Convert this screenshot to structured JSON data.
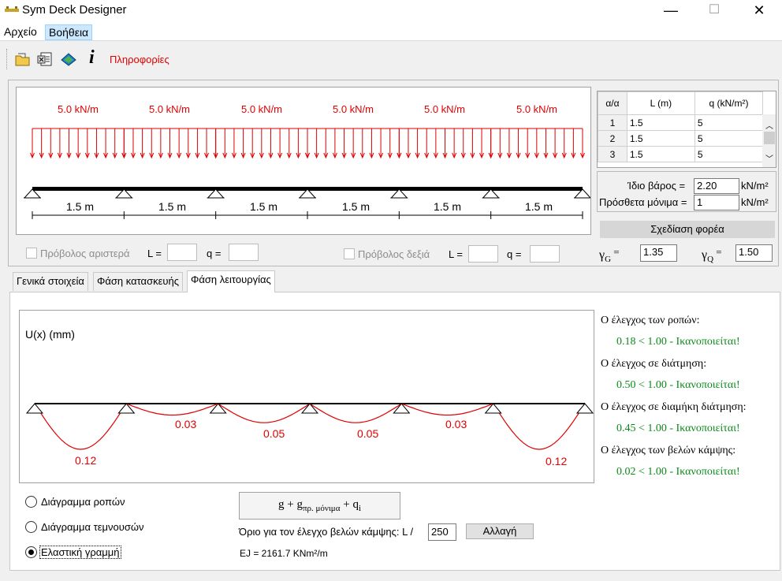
{
  "window": {
    "title": "Sym Deck Designer",
    "minimize": "—",
    "maximize": "☐",
    "close": "✕"
  },
  "menu": {
    "file": "Αρχείο",
    "help": "Βοήθεια"
  },
  "toolbar": {
    "info_label": "Πληροφορίες",
    "info_glyph": "i"
  },
  "beam": {
    "load_labels": [
      "5.0 kN/m",
      "5.0 kN/m",
      "5.0 kN/m",
      "5.0 kN/m",
      "5.0 kN/m",
      "5.0 kN/m"
    ],
    "span_labels": [
      "1.5 m",
      "1.5 m",
      "1.5 m",
      "1.5 m",
      "1.5 m",
      "1.5 m"
    ],
    "load_color": "#e00000"
  },
  "span_table": {
    "headers": [
      "α/α",
      "L (m)",
      "q (kN/m²)"
    ],
    "rows": [
      {
        "n": "1",
        "L": "1.5",
        "q": "5"
      },
      {
        "n": "2",
        "L": "1.5",
        "q": "5"
      },
      {
        "n": "3",
        "L": "1.5",
        "q": "5"
      }
    ]
  },
  "loads": {
    "self_weight_label": "Ίδιο βάρος =",
    "self_weight_value": "2.20",
    "self_weight_unit": "kN/m²",
    "permanent_label": "Πρόσθετα μόνιμα =",
    "permanent_value": "1",
    "permanent_unit": "kN/m²"
  },
  "design_button": "Σχεδίαση φορέα",
  "gamma": {
    "g_label": "γ",
    "g_sub": "G",
    "g_value": "1.35",
    "q_label": "γ",
    "q_sub": "Q",
    "q_value": "1.50",
    "eq": "="
  },
  "cantilevers": {
    "left_label": "Πρόβολος αριστερά",
    "right_label": "Πρόβολος δεξιά",
    "L_label": "L =",
    "q_label": "q ="
  },
  "tabs": [
    "Γενικά στοιχεία",
    "Φάση κατασκευής",
    "Φάση λειτουργίας"
  ],
  "diagram": {
    "axis_label": "U(x) (mm)",
    "value_labels": [
      "0.12",
      "0.03",
      "0.05",
      "0.05",
      "0.03",
      "0.12"
    ],
    "curve_color": "#e00000"
  },
  "checks": [
    {
      "title": "Ο έλεγχος των ροπών:",
      "result": "0.18 < 1.00 - Ικανοποιείται!"
    },
    {
      "title": "Ο έλεγχος σε διάτμηση:",
      "result": "0.50 < 1.00 - Ικανοποιείται!"
    },
    {
      "title": "Ο έλεγχος σε διαμήκη διάτμηση:",
      "result": "0.45 < 1.00 - Ικανοποιείται!"
    },
    {
      "title": "Ο έλεγχος των βελών κάμψης:",
      "result": "0.02 < 1.00 - Ικανοποιείται!"
    }
  ],
  "radios": [
    {
      "label": "Διάγραμμα ροπών",
      "selected": false
    },
    {
      "label": "Διάγραμμα τεμνουσών",
      "selected": false
    },
    {
      "label": "Ελαστική γραμμή",
      "selected": true
    }
  ],
  "combo_button": {
    "g": "g",
    "plus": "+",
    "g_sub": "g",
    "g_sub_text": "πρ. μόνιμα",
    "q": "q",
    "q_sub": "i"
  },
  "deflection": {
    "label": "Όριο για τον έλεγχο βελών κάμψης: L /",
    "value": "250",
    "change_button": "Αλλαγή"
  },
  "ej": "EJ = 2161.7 KNm²/m",
  "colors": {
    "check_green": "#0a8a1a",
    "accent_red": "#e00000"
  }
}
